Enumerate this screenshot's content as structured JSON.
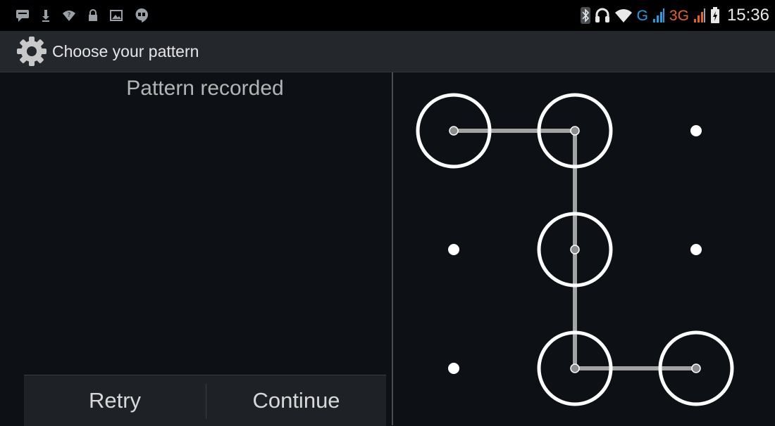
{
  "status_bar": {
    "notification_icons": [
      "message-icon",
      "download-icon",
      "wifi-question-icon",
      "lock-icon",
      "image-icon",
      "hangouts-icon"
    ],
    "system_icons": [
      "bluetooth-icon",
      "headset-icon",
      "wifi-icon",
      "signal-icon",
      "battery-icon"
    ],
    "network_1": "G",
    "network_2": "3G",
    "time": "15:36",
    "colors": {
      "network_1": "#1ea0e6",
      "network_2": "#e8641e"
    }
  },
  "action_bar": {
    "icon": "settings-icon",
    "title": "Choose your pattern"
  },
  "pattern_header": "Pattern recorded",
  "buttons": {
    "retry": "Retry",
    "continue": "Continue"
  },
  "pattern": {
    "grid": 3,
    "sequence": [
      [
        0,
        0
      ],
      [
        0,
        1
      ],
      [
        1,
        1
      ],
      [
        2,
        1
      ],
      [
        2,
        2
      ]
    ],
    "colors": {
      "line": "#a3a3a3",
      "ring": "#ffffff",
      "dot": "#ffffff"
    }
  }
}
